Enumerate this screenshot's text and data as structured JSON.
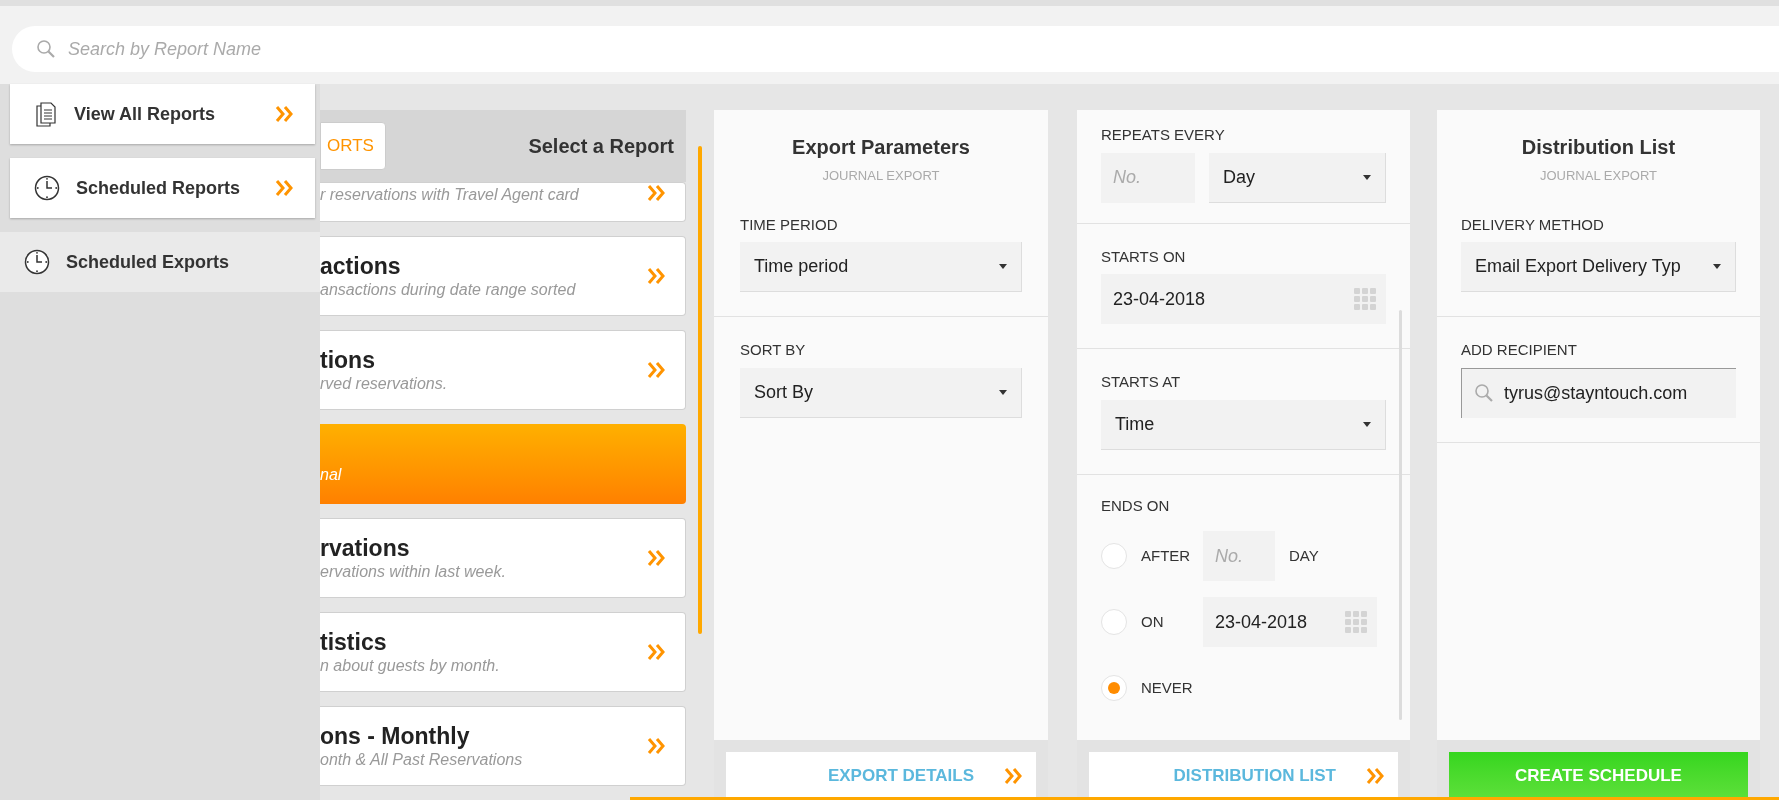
{
  "search": {
    "placeholder": "Search by Report Name"
  },
  "menu": [
    {
      "label": "View All Reports",
      "kind": "document",
      "selected": false
    },
    {
      "label": "Scheduled Reports",
      "kind": "clock",
      "selected": false
    },
    {
      "label": "Scheduled Exports",
      "kind": "clock",
      "selected": true
    }
  ],
  "report_list": {
    "tab_button": "ORTS",
    "heading": "Select a Report",
    "items": [
      {
        "description": "r reservations with Travel Agent card",
        "selected": false
      },
      {
        "title": "actions",
        "description": "ansactions during date range sorted",
        "selected": false
      },
      {
        "title": "tions",
        "description": "rved reservations.",
        "selected": false
      },
      {
        "description": "nal",
        "selected": true
      },
      {
        "title": "rvations",
        "description": "ervations within last week.",
        "selected": false
      },
      {
        "title": "tistics",
        "description": "n about guests by month.",
        "selected": false
      },
      {
        "title": "ons - Monthly",
        "description": "onth & All Past Reservations",
        "selected": false
      }
    ]
  },
  "export_parameters": {
    "title": "Export Parameters",
    "subtitle": "JOURNAL EXPORT",
    "fields": [
      {
        "label": "TIME PERIOD",
        "value": "Time period"
      },
      {
        "label": "SORT BY",
        "value": "Sort By"
      }
    ],
    "footer_button": "EXPORT DETAILS"
  },
  "schedule": {
    "repeats_every": {
      "label": "REPEATS EVERY",
      "count_placeholder": "No.",
      "unit": "Day"
    },
    "starts_on": {
      "label": "STARTS ON",
      "value": "23-04-2018"
    },
    "starts_at": {
      "label": "STARTS AT",
      "value": "Time"
    },
    "ends_on": {
      "label": "ENDS ON",
      "options": [
        {
          "kind": "count",
          "label": "AFTER",
          "placeholder": "No.",
          "unit": "DAY",
          "selected": false
        },
        {
          "kind": "date",
          "label": "ON",
          "value": "23-04-2018",
          "selected": false
        },
        {
          "kind": "plain",
          "label": "NEVER",
          "selected": true
        }
      ]
    },
    "footer_button": "DISTRIBUTION LIST"
  },
  "distribution": {
    "title": "Distribution List",
    "subtitle": "JOURNAL EXPORT",
    "delivery_method": {
      "label": "DELIVERY METHOD",
      "value": "Email Export Delivery Typ"
    },
    "add_recipient": {
      "label": "ADD RECIPIENT",
      "value": "tyrus@stayntouch.com"
    },
    "footer_button": "CREATE SCHEDULE"
  }
}
